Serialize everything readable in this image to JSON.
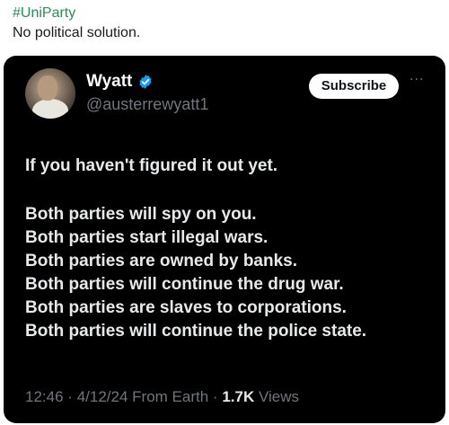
{
  "post": {
    "hashtag": "#UniParty",
    "caption": "No political solution."
  },
  "tweet": {
    "display_name": "Wyatt",
    "handle": "@austerrewyatt1",
    "subscribe_label": "Subscribe",
    "more_label": "···",
    "body": {
      "intro": "If you haven't figured it out yet.",
      "lines": [
        "Both parties will spy on you.",
        "Both parties start illegal wars.",
        "Both parties are owned by banks.",
        "Both parties will continue the drug war.",
        "Both parties are slaves to corporations.",
        "Both parties will continue the police state."
      ]
    },
    "meta": {
      "time": "12:46",
      "date": "4/12/24",
      "source": "From Earth",
      "views_count": "1.7K",
      "views_label": "Views",
      "separator": "·"
    }
  },
  "colors": {
    "hashtag": "#2e8b57",
    "card_background": "#000000",
    "verified_badge": "#1d9bf0",
    "muted_text": "#71767b"
  },
  "icons": {
    "verified": "verified-badge-icon",
    "more": "more-horizontal-icon"
  }
}
